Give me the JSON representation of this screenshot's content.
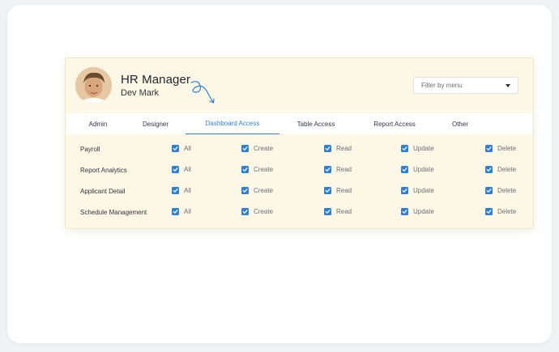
{
  "profile": {
    "title": "HR Manager",
    "name": "Dev Mark"
  },
  "filter": {
    "placeholder": "Filter by menu"
  },
  "tabs": [
    {
      "label": "Admin",
      "active": false
    },
    {
      "label": "Designer",
      "active": false
    },
    {
      "label": "Dashboard Access",
      "active": true
    },
    {
      "label": "Table Access",
      "active": false
    },
    {
      "label": "Report Access",
      "active": false
    },
    {
      "label": "Other",
      "active": false
    }
  ],
  "permissions": {
    "columns": [
      "All",
      "Create",
      "Read",
      "Update",
      "Delete"
    ],
    "rows": [
      {
        "label": "Payroll",
        "checked": [
          true,
          true,
          true,
          true,
          true
        ]
      },
      {
        "label": "Report Analytics",
        "checked": [
          true,
          true,
          true,
          true,
          true
        ]
      },
      {
        "label": "Applicant Detail",
        "checked": [
          true,
          true,
          true,
          true,
          true
        ]
      },
      {
        "label": "Schedule Management",
        "checked": [
          true,
          true,
          true,
          true,
          true
        ]
      }
    ]
  },
  "colors": {
    "accent": "#2f7fd9",
    "panel_bg": "#fdf8e6"
  },
  "icons": {
    "filter_caret": "caret-down-icon",
    "checkbox": "checkmark-icon"
  }
}
